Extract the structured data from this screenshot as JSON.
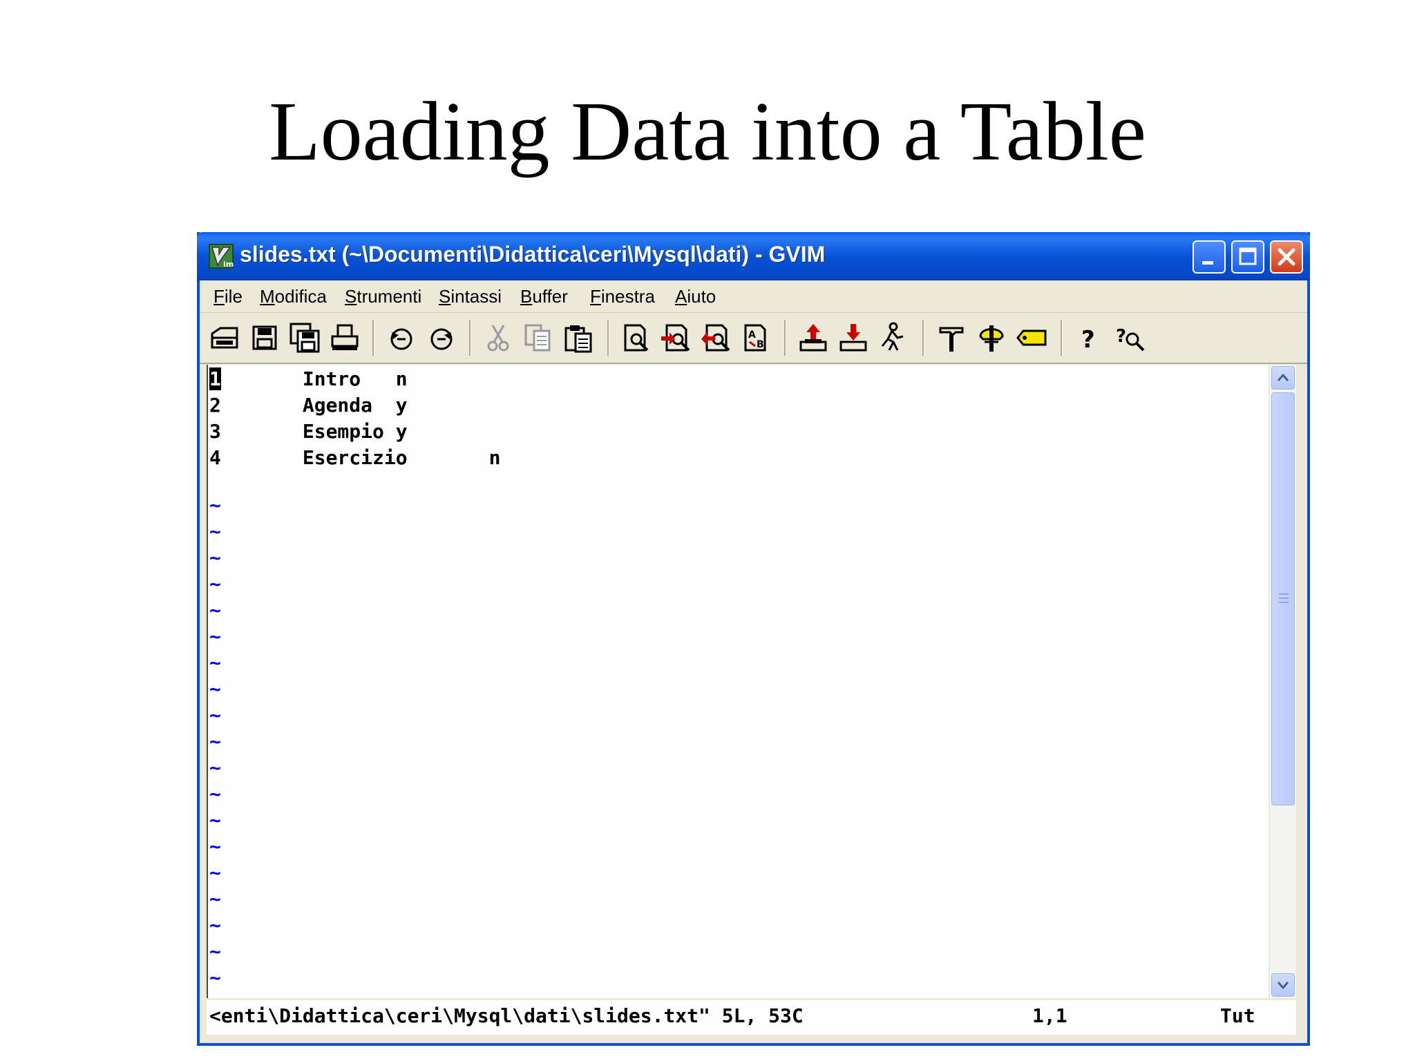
{
  "slide": {
    "title": "Loading Data into a Table"
  },
  "window": {
    "title": "slides.txt (~\\Documenti\\Didattica\\ceri\\Mysql\\dati) - GVIM"
  },
  "menu": {
    "file": {
      "accel": "F",
      "rest": "ile"
    },
    "edit": {
      "accel": "M",
      "rest": "odifica"
    },
    "tools": {
      "accel": "S",
      "rest": "trumenti"
    },
    "syntax": {
      "accel": "S",
      "rest": "intassi"
    },
    "buffers": {
      "accel": "B",
      "rest": "uffer"
    },
    "window": {
      "accel": "F",
      "rest": "inestra"
    },
    "help": {
      "accel": "A",
      "rest": "iuto"
    }
  },
  "toolbar_icons": [
    "open-icon",
    "save-icon",
    "save-all-icon",
    "print-icon",
    "undo-icon",
    "redo-icon",
    "cut-icon",
    "copy-icon",
    "paste-icon",
    "find-icon",
    "find-next-icon",
    "find-prev-icon",
    "replace-icon",
    "load-session-icon",
    "save-session-icon",
    "run-script-icon",
    "make-icon",
    "shell-icon",
    "ctags-icon",
    "help-icon",
    "find-help-icon"
  ],
  "editor": {
    "lines": [
      {
        "num": "1",
        "text": "       Intro   n"
      },
      {
        "num": "2",
        "text": "       Agenda  y"
      },
      {
        "num": "3",
        "text": "       Esempio y"
      },
      {
        "num": "4",
        "text": "       Esercizio       n"
      }
    ],
    "tilde": "~"
  },
  "status": {
    "file": "<enti\\Didattica\\ceri\\Mysql\\dati\\slides.txt\" 5L, 53C",
    "position": "1,1",
    "scroll": "Tut"
  },
  "colors": {
    "titlebar": "#0852d6",
    "tilde": "#0000ee",
    "chrome": "#ece9d8"
  }
}
